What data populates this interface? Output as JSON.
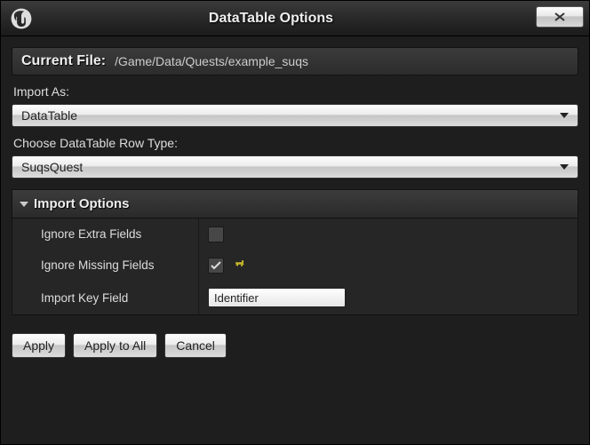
{
  "window": {
    "title": "DataTable Options"
  },
  "file": {
    "label": "Current File:",
    "path": "/Game/Data/Quests/example_suqs"
  },
  "importAs": {
    "label": "Import As:",
    "value": "DataTable"
  },
  "rowType": {
    "label": "Choose DataTable Row Type:",
    "value": "SuqsQuest"
  },
  "importOptions": {
    "header": "Import Options",
    "rows": {
      "ignoreExtra": {
        "label": "Ignore Extra Fields",
        "checked": false
      },
      "ignoreMissing": {
        "label": "Ignore Missing Fields",
        "checked": true
      },
      "importKey": {
        "label": "Import Key Field",
        "value": "Identifier"
      }
    }
  },
  "buttons": {
    "apply": "Apply",
    "applyAll": "Apply to All",
    "cancel": "Cancel"
  }
}
